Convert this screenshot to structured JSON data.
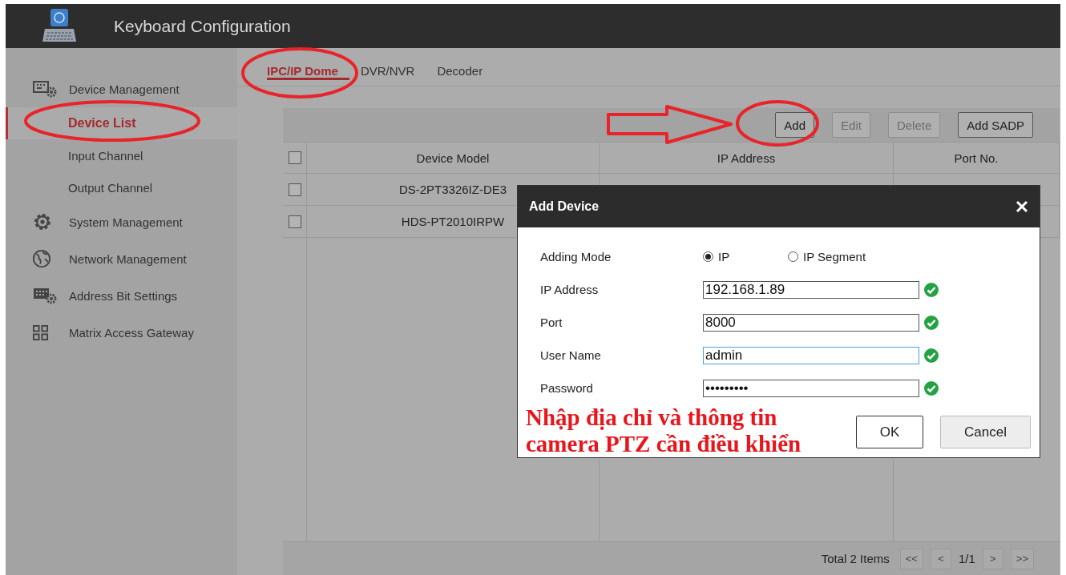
{
  "window": {
    "title": "Keyboard Configuration"
  },
  "sidebar": {
    "items": [
      {
        "label": "Device Management",
        "kind": "device",
        "children": [
          {
            "label": "Device List",
            "selected": true
          },
          {
            "label": "Input Channel",
            "selected": false
          },
          {
            "label": "Output Channel",
            "selected": false
          }
        ]
      },
      {
        "label": "System Management",
        "kind": "gear"
      },
      {
        "label": "Network Management",
        "kind": "globe"
      },
      {
        "label": "Address Bit Settings",
        "kind": "address"
      },
      {
        "label": "Matrix Access Gateway",
        "kind": "grid"
      }
    ]
  },
  "tabs": [
    {
      "label": "IPC/IP Dome",
      "selected": true
    },
    {
      "label": "DVR/NVR",
      "selected": false
    },
    {
      "label": "Decoder",
      "selected": false
    }
  ],
  "toolbar": {
    "buttons": [
      {
        "label": "Add",
        "disabled": false
      },
      {
        "label": "Edit",
        "disabled": true
      },
      {
        "label": "Delete",
        "disabled": true
      },
      {
        "label": "Add SADP",
        "disabled": false
      }
    ]
  },
  "table": {
    "columns": [
      "Device Model",
      "IP Address",
      "Port No."
    ],
    "header_checked": false,
    "rows": [
      {
        "checked": false,
        "cells": [
          "DS-2PT3326IZ-DE3"
        ]
      },
      {
        "checked": false,
        "cells": [
          "HDS-PT2010IRPW"
        ]
      }
    ]
  },
  "footer": {
    "total": "Total 2 Items",
    "pager": [
      {
        "kind": "button",
        "label": "<<"
      },
      {
        "kind": "button",
        "label": "<"
      },
      {
        "kind": "page",
        "label": "1/1"
      },
      {
        "kind": "button",
        "label": ">"
      },
      {
        "kind": "button",
        "label": ">>"
      }
    ]
  },
  "dialog": {
    "title": "Add Device",
    "mode": {
      "label": "Adding Mode",
      "options": [
        {
          "label": "IP",
          "selected": true
        },
        {
          "label": "IP Segment",
          "selected": false
        }
      ]
    },
    "fields": [
      {
        "label": "IP Address",
        "value": "192.168.1.89",
        "valid": true,
        "focused": false
      },
      {
        "label": "Port",
        "value": "8000",
        "valid": true,
        "focused": false
      },
      {
        "label": "User Name",
        "value": "admin",
        "valid": true,
        "focused": true
      },
      {
        "label": "Password",
        "value": "•••••••••",
        "valid": true,
        "focused": false
      }
    ],
    "note": "Nhập địa chỉ và thông tin\ncamera PTZ cần điều khiển",
    "buttons": [
      {
        "label": "OK",
        "kind": "primary"
      },
      {
        "label": "Cancel",
        "kind": "secondary"
      }
    ]
  }
}
